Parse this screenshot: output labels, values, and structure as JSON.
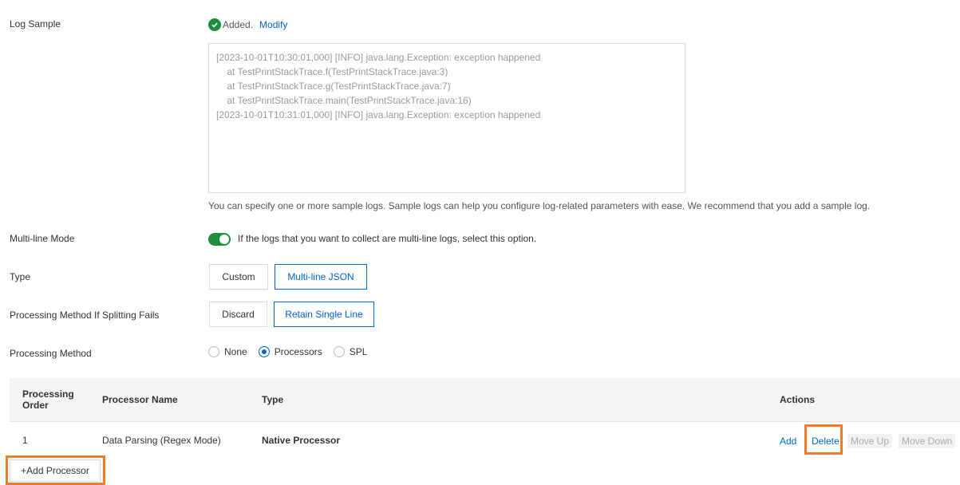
{
  "log_sample": {
    "label": "Log Sample",
    "status_text": "Added.",
    "modify_link": "Modify",
    "lines": [
      "[2023-10-01T10:30:01,000] [INFO] java.lang.Exception: exception happened",
      "    at TestPrintStackTrace.f(TestPrintStackTrace.java:3)",
      "    at TestPrintStackTrace.g(TestPrintStackTrace.java:7)",
      "    at TestPrintStackTrace.main(TestPrintStackTrace.java:16)",
      "[2023-10-01T10:31:01,000] [INFO] java.lang.Exception: exception happened"
    ],
    "hint": "You can specify one or more sample logs. Sample logs can help you configure log-related parameters with ease. We recommend that you add a sample log."
  },
  "multiline": {
    "label": "Multi-line Mode",
    "description": "If the logs that you want to collect are multi-line logs, select this option.",
    "enabled": true
  },
  "type": {
    "label": "Type",
    "options": [
      "Custom",
      "Multi-line JSON"
    ],
    "selected": "Multi-line JSON"
  },
  "split_fail": {
    "label": "Processing Method If Splitting Fails",
    "options": [
      "Discard",
      "Retain Single Line"
    ],
    "selected": "Retain Single Line"
  },
  "processing_method": {
    "label": "Processing Method",
    "options": [
      "None",
      "Processors",
      "SPL"
    ],
    "selected": "Processors"
  },
  "table": {
    "headers": {
      "order_line1": "Processing",
      "order_line2": "Order",
      "name": "Processor Name",
      "type": "Type",
      "actions": "Actions"
    },
    "rows": [
      {
        "order": "1",
        "name": "Data Parsing (Regex Mode)",
        "type": "Native Processor",
        "actions": [
          "Add",
          "Delete",
          "Move Up",
          "Move Down"
        ]
      }
    ]
  },
  "add_processor": "+Add Processor",
  "colors": {
    "accent": "#0064c8",
    "success": "#1e8e3e",
    "highlight": "#f07c2a"
  }
}
